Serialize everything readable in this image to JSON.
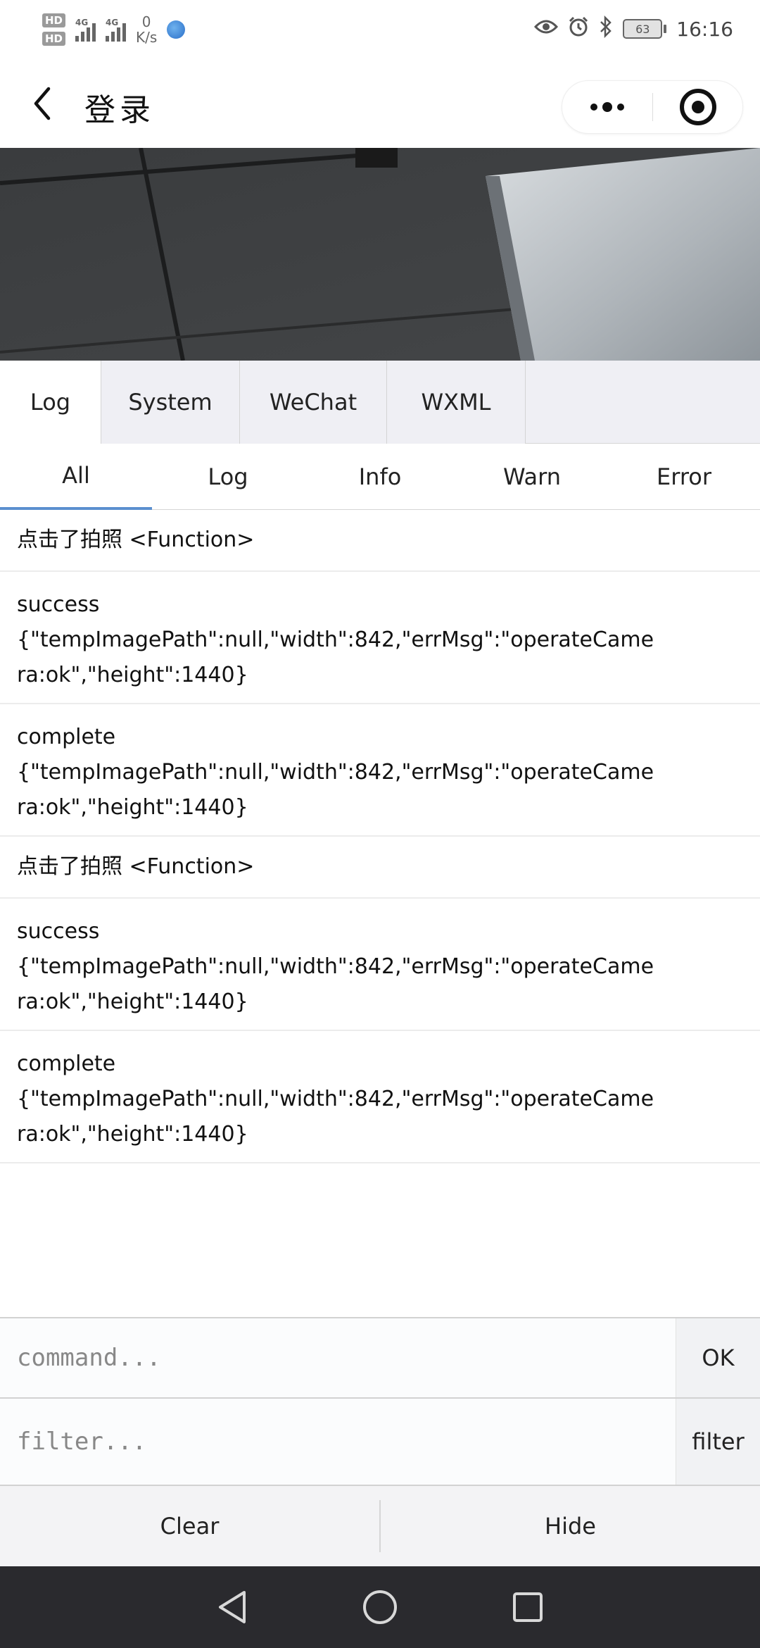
{
  "status_bar": {
    "hd1": "HD",
    "hd2": "HD",
    "net1": "4G",
    "net2": "4G",
    "speed_value": "0",
    "speed_unit": "K/s",
    "battery": "63",
    "time": "16:16"
  },
  "nav": {
    "title": "登录",
    "back_icon": "chevron-left-icon",
    "more_icon": "more-dots-icon",
    "close_icon": "target-circle-icon"
  },
  "tabs_primary": [
    "Log",
    "System",
    "WeChat",
    "WXML"
  ],
  "tabs_primary_active": "Log",
  "tabs_filter": [
    "All",
    "Log",
    "Info",
    "Warn",
    "Error"
  ],
  "tabs_filter_active": "All",
  "log_entries": [
    {
      "lines": [
        "点击了拍照 <Function>"
      ]
    },
    {
      "lines": [
        "success",
        "{\"tempImagePath\":null,\"width\":842,\"errMsg\":\"operateCame",
        "ra:ok\",\"height\":1440}"
      ]
    },
    {
      "lines": [
        "complete",
        "{\"tempImagePath\":null,\"width\":842,\"errMsg\":\"operateCame",
        "ra:ok\",\"height\":1440}"
      ]
    },
    {
      "lines": [
        "点击了拍照 <Function>"
      ]
    },
    {
      "lines": [
        "success",
        "{\"tempImagePath\":null,\"width\":842,\"errMsg\":\"operateCame",
        "ra:ok\",\"height\":1440}"
      ]
    },
    {
      "lines": [
        "complete",
        "{\"tempImagePath\":null,\"width\":842,\"errMsg\":\"operateCame",
        "ra:ok\",\"height\":1440}"
      ]
    }
  ],
  "command": {
    "placeholder": "command...",
    "button": "OK"
  },
  "filter": {
    "placeholder": "filter...",
    "button": "filter"
  },
  "bottom": {
    "clear": "Clear",
    "hide": "Hide"
  },
  "colors": {
    "active_tab_underline": "#5b8fcf",
    "system_nav_bg": "#2a2a2e",
    "tab_bg": "#efeff4"
  }
}
